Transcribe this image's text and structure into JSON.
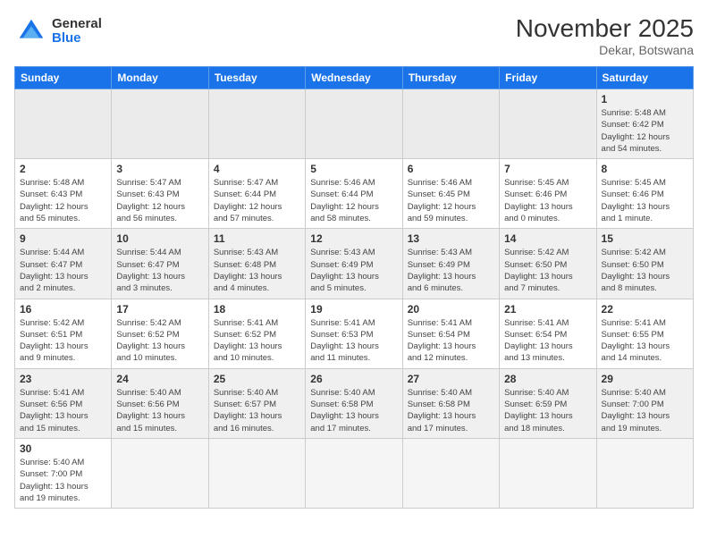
{
  "logo": {
    "general": "General",
    "blue": "Blue"
  },
  "header": {
    "month": "November 2025",
    "location": "Dekar, Botswana"
  },
  "weekdays": [
    "Sunday",
    "Monday",
    "Tuesday",
    "Wednesday",
    "Thursday",
    "Friday",
    "Saturday"
  ],
  "weeks": [
    [
      {
        "day": "",
        "info": ""
      },
      {
        "day": "",
        "info": ""
      },
      {
        "day": "",
        "info": ""
      },
      {
        "day": "",
        "info": ""
      },
      {
        "day": "",
        "info": ""
      },
      {
        "day": "",
        "info": ""
      },
      {
        "day": "1",
        "info": "Sunrise: 5:48 AM\nSunset: 6:42 PM\nDaylight: 12 hours\nand 54 minutes."
      }
    ],
    [
      {
        "day": "2",
        "info": "Sunrise: 5:48 AM\nSunset: 6:43 PM\nDaylight: 12 hours\nand 55 minutes."
      },
      {
        "day": "3",
        "info": "Sunrise: 5:47 AM\nSunset: 6:43 PM\nDaylight: 12 hours\nand 56 minutes."
      },
      {
        "day": "4",
        "info": "Sunrise: 5:47 AM\nSunset: 6:44 PM\nDaylight: 12 hours\nand 57 minutes."
      },
      {
        "day": "5",
        "info": "Sunrise: 5:46 AM\nSunset: 6:44 PM\nDaylight: 12 hours\nand 58 minutes."
      },
      {
        "day": "6",
        "info": "Sunrise: 5:46 AM\nSunset: 6:45 PM\nDaylight: 12 hours\nand 59 minutes."
      },
      {
        "day": "7",
        "info": "Sunrise: 5:45 AM\nSunset: 6:46 PM\nDaylight: 13 hours\nand 0 minutes."
      },
      {
        "day": "8",
        "info": "Sunrise: 5:45 AM\nSunset: 6:46 PM\nDaylight: 13 hours\nand 1 minute."
      }
    ],
    [
      {
        "day": "9",
        "info": "Sunrise: 5:44 AM\nSunset: 6:47 PM\nDaylight: 13 hours\nand 2 minutes."
      },
      {
        "day": "10",
        "info": "Sunrise: 5:44 AM\nSunset: 6:47 PM\nDaylight: 13 hours\nand 3 minutes."
      },
      {
        "day": "11",
        "info": "Sunrise: 5:43 AM\nSunset: 6:48 PM\nDaylight: 13 hours\nand 4 minutes."
      },
      {
        "day": "12",
        "info": "Sunrise: 5:43 AM\nSunset: 6:49 PM\nDaylight: 13 hours\nand 5 minutes."
      },
      {
        "day": "13",
        "info": "Sunrise: 5:43 AM\nSunset: 6:49 PM\nDaylight: 13 hours\nand 6 minutes."
      },
      {
        "day": "14",
        "info": "Sunrise: 5:42 AM\nSunset: 6:50 PM\nDaylight: 13 hours\nand 7 minutes."
      },
      {
        "day": "15",
        "info": "Sunrise: 5:42 AM\nSunset: 6:50 PM\nDaylight: 13 hours\nand 8 minutes."
      }
    ],
    [
      {
        "day": "16",
        "info": "Sunrise: 5:42 AM\nSunset: 6:51 PM\nDaylight: 13 hours\nand 9 minutes."
      },
      {
        "day": "17",
        "info": "Sunrise: 5:42 AM\nSunset: 6:52 PM\nDaylight: 13 hours\nand 10 minutes."
      },
      {
        "day": "18",
        "info": "Sunrise: 5:41 AM\nSunset: 6:52 PM\nDaylight: 13 hours\nand 10 minutes."
      },
      {
        "day": "19",
        "info": "Sunrise: 5:41 AM\nSunset: 6:53 PM\nDaylight: 13 hours\nand 11 minutes."
      },
      {
        "day": "20",
        "info": "Sunrise: 5:41 AM\nSunset: 6:54 PM\nDaylight: 13 hours\nand 12 minutes."
      },
      {
        "day": "21",
        "info": "Sunrise: 5:41 AM\nSunset: 6:54 PM\nDaylight: 13 hours\nand 13 minutes."
      },
      {
        "day": "22",
        "info": "Sunrise: 5:41 AM\nSunset: 6:55 PM\nDaylight: 13 hours\nand 14 minutes."
      }
    ],
    [
      {
        "day": "23",
        "info": "Sunrise: 5:41 AM\nSunset: 6:56 PM\nDaylight: 13 hours\nand 15 minutes."
      },
      {
        "day": "24",
        "info": "Sunrise: 5:40 AM\nSunset: 6:56 PM\nDaylight: 13 hours\nand 15 minutes."
      },
      {
        "day": "25",
        "info": "Sunrise: 5:40 AM\nSunset: 6:57 PM\nDaylight: 13 hours\nand 16 minutes."
      },
      {
        "day": "26",
        "info": "Sunrise: 5:40 AM\nSunset: 6:58 PM\nDaylight: 13 hours\nand 17 minutes."
      },
      {
        "day": "27",
        "info": "Sunrise: 5:40 AM\nSunset: 6:58 PM\nDaylight: 13 hours\nand 17 minutes."
      },
      {
        "day": "28",
        "info": "Sunrise: 5:40 AM\nSunset: 6:59 PM\nDaylight: 13 hours\nand 18 minutes."
      },
      {
        "day": "29",
        "info": "Sunrise: 5:40 AM\nSunset: 7:00 PM\nDaylight: 13 hours\nand 19 minutes."
      }
    ],
    [
      {
        "day": "30",
        "info": "Sunrise: 5:40 AM\nSunset: 7:00 PM\nDaylight: 13 hours\nand 19 minutes."
      },
      {
        "day": "",
        "info": ""
      },
      {
        "day": "",
        "info": ""
      },
      {
        "day": "",
        "info": ""
      },
      {
        "day": "",
        "info": ""
      },
      {
        "day": "",
        "info": ""
      },
      {
        "day": "",
        "info": ""
      }
    ]
  ]
}
